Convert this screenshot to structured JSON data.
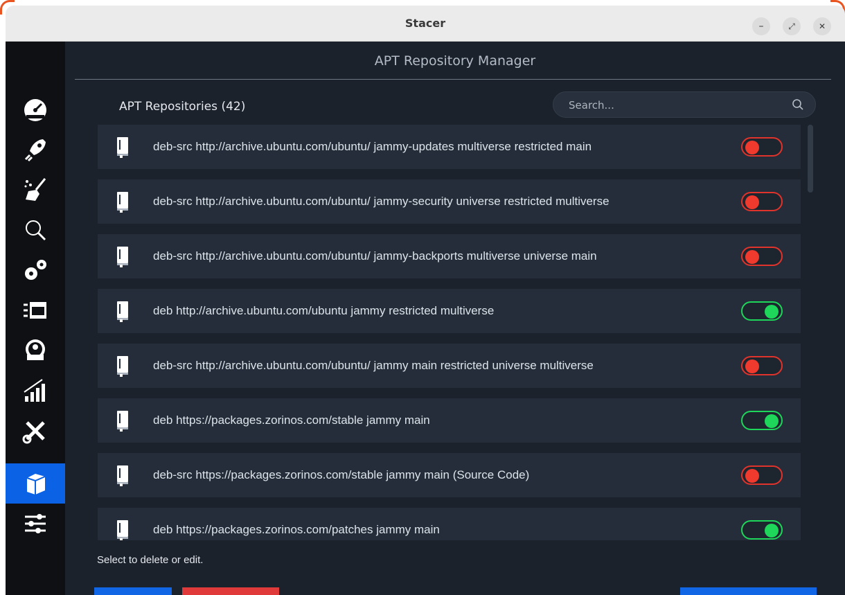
{
  "window": {
    "title": "Stacer",
    "controls": {
      "minimize": "–",
      "maximize": "⤢",
      "close": "✕"
    }
  },
  "sidebar": {
    "items": [
      {
        "name": "dashboard",
        "icon": "speedometer-icon",
        "active": false
      },
      {
        "name": "startup-apps",
        "icon": "rocket-icon",
        "active": false
      },
      {
        "name": "system-cleaner",
        "icon": "broom-icon",
        "active": false
      },
      {
        "name": "search",
        "icon": "magnifier-icon",
        "active": false
      },
      {
        "name": "services",
        "icon": "gears-icon",
        "active": false
      },
      {
        "name": "processes",
        "icon": "list-window-icon",
        "active": false
      },
      {
        "name": "uninstaller",
        "icon": "package-icon",
        "active": false
      },
      {
        "name": "resources",
        "icon": "chart-icon",
        "active": false
      },
      {
        "name": "helpers",
        "icon": "tools-icon",
        "active": false
      },
      {
        "name": "apt-repository-manager",
        "icon": "box-icon",
        "active": true
      },
      {
        "name": "settings",
        "icon": "sliders-icon",
        "active": false
      }
    ]
  },
  "main": {
    "header": "APT Repository Manager",
    "section_title": "APT Repositories (42)",
    "search": {
      "placeholder": "Search...",
      "value": ""
    },
    "repositories": [
      {
        "text": "deb-src http://archive.ubuntu.com/ubuntu/ jammy-updates multiverse restricted main",
        "enabled": false
      },
      {
        "text": "deb-src http://archive.ubuntu.com/ubuntu/ jammy-security universe restricted multiverse",
        "enabled": false
      },
      {
        "text": "deb-src http://archive.ubuntu.com/ubuntu/ jammy-backports multiverse universe main",
        "enabled": false
      },
      {
        "text": "deb http://archive.ubuntu.com/ubuntu jammy restricted multiverse",
        "enabled": true
      },
      {
        "text": "deb-src http://archive.ubuntu.com/ubuntu/ jammy main restricted universe multiverse",
        "enabled": false
      },
      {
        "text": "deb https://packages.zorinos.com/stable jammy main",
        "enabled": true
      },
      {
        "text": "deb-src https://packages.zorinos.com/stable jammy main (Source Code)",
        "enabled": false
      },
      {
        "text": "deb https://packages.zorinos.com/patches jammy main",
        "enabled": true
      }
    ],
    "footer_hint": "Select to delete or edit."
  },
  "colors": {
    "accent": "#0b62e4",
    "toggle_on": "#1ed65a",
    "toggle_off": "#e0332b",
    "background": "#1b222c",
    "row": "#242d39"
  }
}
